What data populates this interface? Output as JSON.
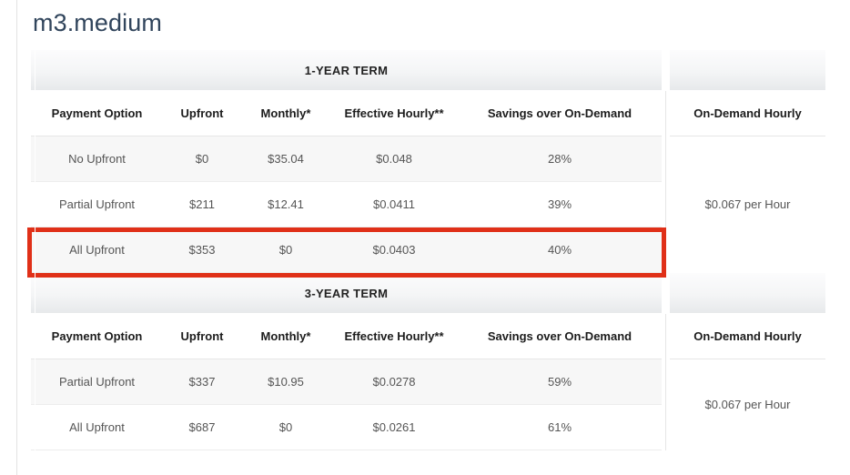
{
  "page": {
    "title": "m3.medium"
  },
  "columns": {
    "payment_option": "Payment Option",
    "upfront": "Upfront",
    "monthly": "Monthly*",
    "effective_hourly": "Effective Hourly**",
    "savings": "Savings over On-Demand",
    "on_demand_hourly": "On-Demand Hourly"
  },
  "colors": {
    "highlight_border": "#e03018",
    "title_text": "#31455c",
    "row_alt_background": "#f7f7f7",
    "band_gradient_top": "#fcfcfd",
    "band_gradient_bottom": "#e7e9eb"
  },
  "sections": [
    {
      "band_label": "1-YEAR TERM",
      "on_demand_value": "$0.067 per Hour",
      "rows": [
        {
          "payment_option": "No Upfront",
          "upfront": "$0",
          "monthly": "$35.04",
          "effective_hourly": "$0.048",
          "savings": "28%",
          "highlighted": false
        },
        {
          "payment_option": "Partial Upfront",
          "upfront": "$211",
          "monthly": "$12.41",
          "effective_hourly": "$0.0411",
          "savings": "39%",
          "highlighted": false
        },
        {
          "payment_option": "All Upfront",
          "upfront": "$353",
          "monthly": "$0",
          "effective_hourly": "$0.0403",
          "savings": "40%",
          "highlighted": true
        }
      ]
    },
    {
      "band_label": "3-YEAR TERM",
      "on_demand_value": "$0.067 per Hour",
      "rows": [
        {
          "payment_option": "Partial Upfront",
          "upfront": "$337",
          "monthly": "$10.95",
          "effective_hourly": "$0.0278",
          "savings": "59%",
          "highlighted": false
        },
        {
          "payment_option": "All Upfront",
          "upfront": "$687",
          "monthly": "$0",
          "effective_hourly": "$0.0261",
          "savings": "61%",
          "highlighted": false
        }
      ]
    }
  ]
}
